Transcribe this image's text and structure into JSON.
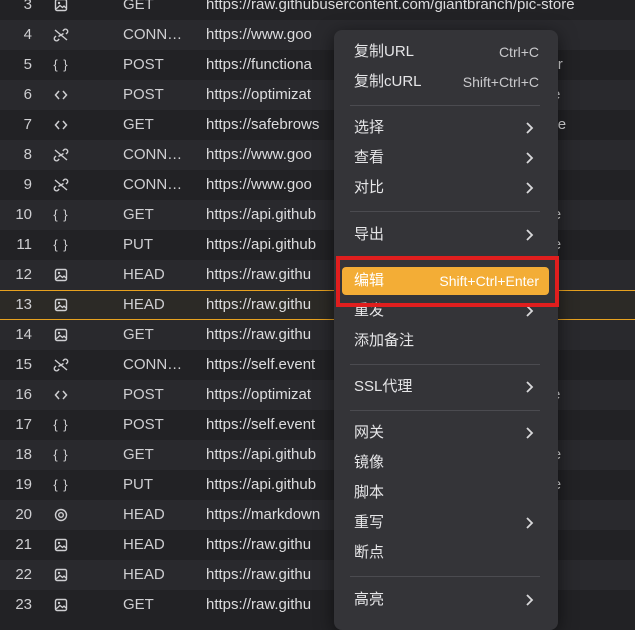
{
  "rows": [
    {
      "num": "3",
      "icon": "image-icon",
      "method": "GET",
      "url": "https://raw.githubusercontent.com/giantbranch/pic-store"
    },
    {
      "num": "4",
      "icon": "unlink-icon",
      "method": "CONN…",
      "url": "https://www.goo"
    },
    {
      "num": "5",
      "icon": "json-braces-icon",
      "method": "POST",
      "url": "https://functiona                                          neCollector"
    },
    {
      "num": "6",
      "icon": "code-icon",
      "method": "POST",
      "url": "https://optimizat                                          1:GetMode"
    },
    {
      "num": "7",
      "icon": "code-icon",
      "method": "GET",
      "url": "https://safebrows                                          ListUpdate"
    },
    {
      "num": "8",
      "icon": "unlink-icon",
      "method": "CONN…",
      "url": "https://www.goo"
    },
    {
      "num": "9",
      "icon": "unlink-icon",
      "method": "CONN…",
      "url": "https://www.goo"
    },
    {
      "num": "10",
      "icon": "json-braces-icon",
      "method": "GET",
      "url": "https://api.github                                         store/conte"
    },
    {
      "num": "11",
      "icon": "json-braces-icon",
      "method": "PUT",
      "url": "https://api.github                                         store/conte"
    },
    {
      "num": "12",
      "icon": "image-icon",
      "method": "HEAD",
      "url": "https://raw.githu                                          /pic-store"
    },
    {
      "num": "13",
      "icon": "image-icon",
      "method": "HEAD",
      "url": "https://raw.githu                                          /pic-store"
    },
    {
      "num": "14",
      "icon": "image-icon",
      "method": "GET",
      "url": "https://raw.githu                                          /pic-store"
    },
    {
      "num": "15",
      "icon": "unlink-icon",
      "method": "CONN…",
      "url": "https://self.event"
    },
    {
      "num": "16",
      "icon": "code-icon",
      "method": "POST",
      "url": "https://optimizat                                          1:GetMode"
    },
    {
      "num": "17",
      "icon": "json-braces-icon",
      "method": "POST",
      "url": "https://self.event                                         ector/1.0/"
    },
    {
      "num": "18",
      "icon": "json-braces-icon",
      "method": "GET",
      "url": "https://api.github                                         store/conte"
    },
    {
      "num": "19",
      "icon": "json-braces-icon",
      "method": "PUT",
      "url": "https://api.github                                         store/conte"
    },
    {
      "num": "20",
      "icon": "record-icon",
      "method": "HEAD",
      "url": "https://markdown                                            er.gif"
    },
    {
      "num": "21",
      "icon": "image-icon",
      "method": "HEAD",
      "url": "https://raw.githu                                          /pic-store"
    },
    {
      "num": "22",
      "icon": "image-icon",
      "method": "HEAD",
      "url": "https://raw.githu                                          /pic-store"
    },
    {
      "num": "23",
      "icon": "image-icon",
      "method": "GET",
      "url": "https://raw.githu                                          /pic-store"
    }
  ],
  "selected_row": "13",
  "menu": {
    "copy_url": {
      "label": "复制URL",
      "shortcut": "Ctrl+C"
    },
    "copy_curl": {
      "label": "复制cURL",
      "shortcut": "Shift+Ctrl+C"
    },
    "select": {
      "label": "选择"
    },
    "view": {
      "label": "查看"
    },
    "compare": {
      "label": "对比"
    },
    "export": {
      "label": "导出"
    },
    "edit": {
      "label": "编辑",
      "shortcut": "Shift+Ctrl+Enter"
    },
    "resend": {
      "label": "重发"
    },
    "add_note": {
      "label": "添加备注"
    },
    "ssl_proxy": {
      "label": "SSL代理"
    },
    "gateway": {
      "label": "网关"
    },
    "mirror": {
      "label": "镜像"
    },
    "script": {
      "label": "脚本"
    },
    "rewrite": {
      "label": "重写"
    },
    "breakpoint": {
      "label": "断点"
    },
    "highlight": {
      "label": "高亮"
    }
  },
  "colors": {
    "background": "#222225",
    "row_alt": "#29292d",
    "menu_bg": "#343438",
    "accent": "#f3ad36",
    "selection_line": "#e8a21f",
    "annotation_red": "#e01e1e"
  }
}
